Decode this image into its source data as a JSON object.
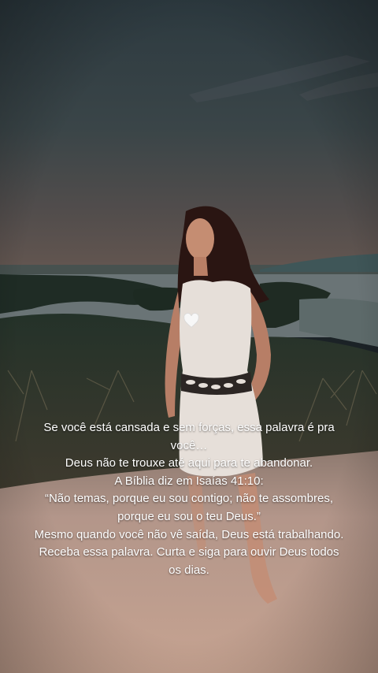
{
  "caption": {
    "lines": [
      "Se você está cansada e sem forças, essa palavra é pra você…",
      "Deus não te trouxe até aqui para te abandonar.",
      "A Bíblia diz em Isaías 41:10:",
      "“Não temas, porque eu sou contigo; não te assombres, porque eu sou o teu Deus.”",
      "Mesmo quando você não vê saída, Deus está trabalhando.",
      "Receba essa palavra. Curta e siga para ouvir Deus todos os dias."
    ]
  },
  "icons": {
    "heart": "white-heart-emoji"
  },
  "colors": {
    "sky_top": "#2e3b41",
    "sky_horizon": "#5a5552",
    "sand": "#c9a78f",
    "dress": "#e8e2dc",
    "hair": "#2a1412"
  }
}
